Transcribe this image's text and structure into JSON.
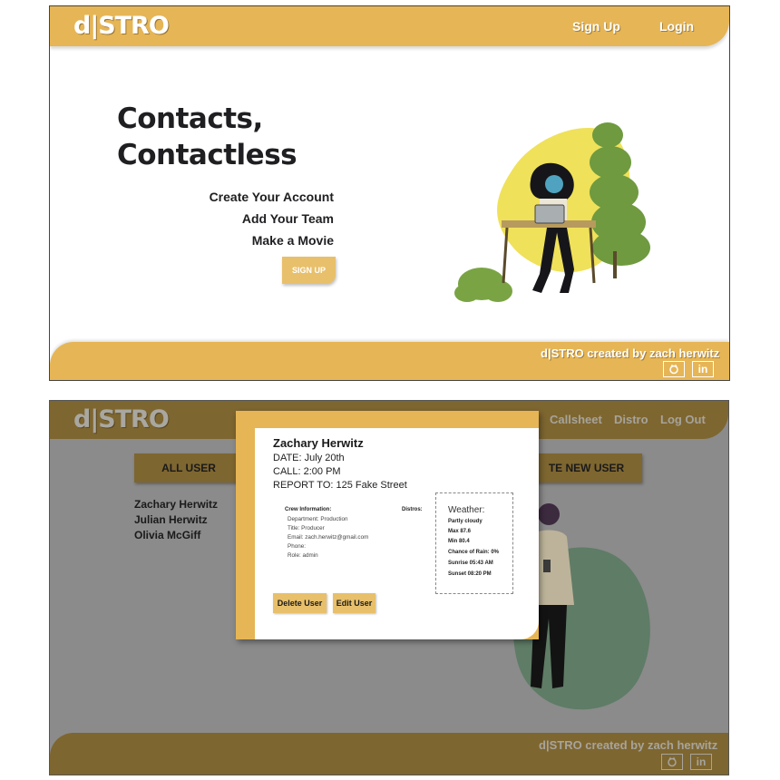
{
  "landing": {
    "logo": "d|STRO",
    "nav": {
      "signup": "Sign Up",
      "login": "Login"
    },
    "hero_line1": "Contacts,",
    "hero_line2": "Contactless",
    "taglines": [
      "Create Your Account",
      "Add Your Team",
      "Make a Movie"
    ],
    "cta": "SIGN UP",
    "footer_credit": "d|STRO created by zach herwitz",
    "footer_icons": [
      "github-icon",
      "linkedin-icon"
    ],
    "linkedin_text": "in",
    "colors": {
      "accent": "#e6b555",
      "dark_text": "#1f1f22"
    }
  },
  "dashboard": {
    "logo": "d|STRO",
    "nav": {
      "callsheet": "Callsheet",
      "distro": "Distro",
      "logout": "Log Out"
    },
    "tab_left": "ALL USER",
    "tab_right": "TE NEW USER",
    "users": [
      "Zachary Herwitz",
      "Julian Herwitz",
      "Olivia McGiff"
    ],
    "footer_credit": "d|STRO created by zach herwitz",
    "linkedin_text": "in",
    "colors": {
      "overlay_header": "#7e6630",
      "overlay_bg": "#8b8b8b"
    }
  },
  "modal": {
    "name": "Zachary Herwitz",
    "date": "DATE: July 20th",
    "call": "CALL: 2:00 PM",
    "report": "REPORT TO: 125 Fake Street",
    "crew_heading": "Crew Information:",
    "distros_heading": "Distros:",
    "crew_lines": [
      "Department: Production",
      "Title: Producer",
      "Email: zach.herwitz@gmail.com",
      "Phone:",
      "Role: admin"
    ],
    "weather": {
      "title": "Weather:",
      "lines": [
        "Partly cloudy",
        "Max 87.6",
        "Min 80.4",
        "Chance of Rain: 0%",
        "Sunrise 05:43 AM",
        "Sunset 08:20 PM"
      ]
    },
    "delete_button": "Delete User",
    "edit_button": "Edit User"
  }
}
